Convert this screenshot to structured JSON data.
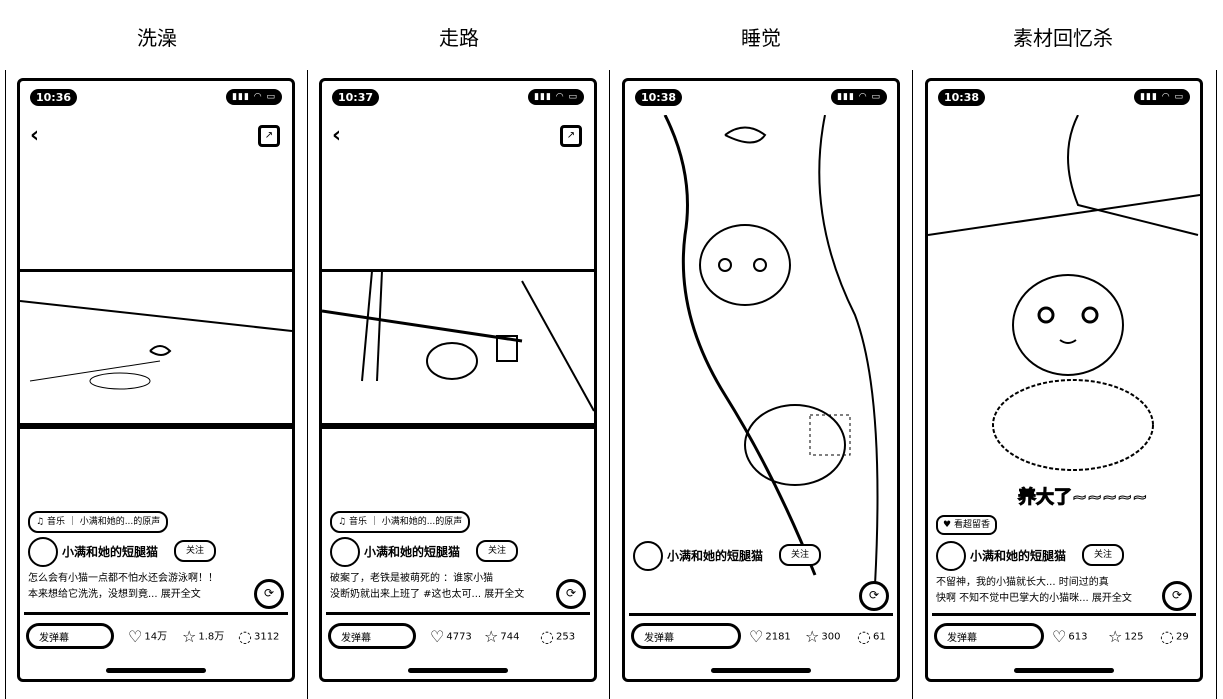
{
  "columns": [
    {
      "title": "洗澡",
      "time": "10:36",
      "music_label": "音乐",
      "music_text": "小满和她的...的原声",
      "username": "小满和她的短腿猫",
      "follow": "关注",
      "desc_line1": "怎么会有小猫一点都不怕水还会游泳啊！！",
      "desc_line2": "本来想给它洗洗，没想到竟... 展开全文",
      "danmu": "发弹幕",
      "likes": "14万",
      "stars": "1.8万",
      "comments": "3112"
    },
    {
      "title": "走路",
      "time": "10:37",
      "music_label": "音乐",
      "music_text": "小满和她的...的原声",
      "username": "小满和她的短腿猫",
      "follow": "关注",
      "desc_line1": "破案了，老铁是被萌死的 ：谁家小猫",
      "desc_line2": "没断奶就出来上班了 #这也太可... 展开全文",
      "danmu": "发弹幕",
      "likes": "4773",
      "stars": "744",
      "comments": "253"
    },
    {
      "title": "睡觉",
      "time": "10:38",
      "username": "小满和她的短腿猫",
      "follow": "关注",
      "desc_line1": "",
      "desc_line2": "",
      "danmu": "发弹幕",
      "likes": "2181",
      "stars": "300",
      "comments": "61"
    },
    {
      "title": "素材回忆杀",
      "time": "10:38",
      "chip": "看超留香",
      "overlay": "养大了~~~~~",
      "username": "小满和她的短腿猫",
      "follow": "关注",
      "desc_line1": "不留神，我的小猫就长大... 时间过的真",
      "desc_line2": "快啊 不知不觉中巴掌大的小猫咪... 展开全文",
      "danmu": "发弹幕",
      "likes": "613",
      "stars": "125",
      "comments": "29"
    }
  ],
  "icons": {
    "back": "chevron-left-icon",
    "share": "share-icon",
    "like": "heart-icon",
    "star": "star-icon",
    "comment": "comment-icon",
    "repost": "repost-icon"
  }
}
